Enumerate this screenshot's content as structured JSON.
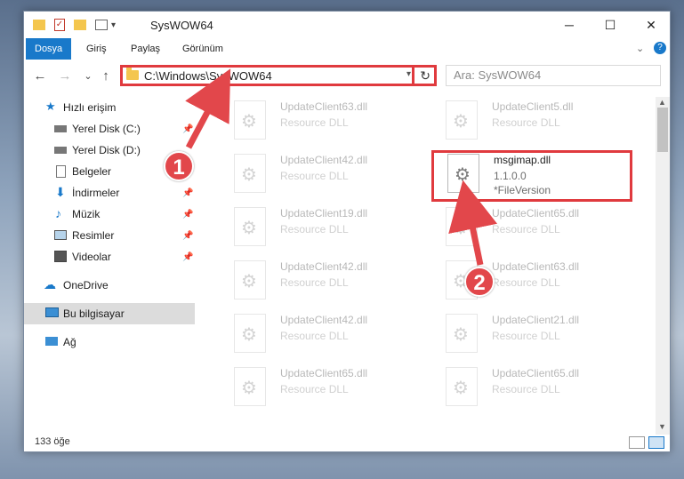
{
  "window": {
    "title": "SysWOW64",
    "controls": {
      "minimize": "─",
      "maximize": "☐",
      "close": "✕"
    }
  },
  "ribbon": {
    "tabs": [
      {
        "label": "Dosya",
        "active": true
      },
      {
        "label": "Giriş"
      },
      {
        "label": "Paylaş"
      },
      {
        "label": "Görünüm"
      }
    ],
    "help": "?"
  },
  "navigation": {
    "back": "←",
    "forward": "→",
    "recent": "⌄",
    "up": "↑",
    "address": "C:\\Windows\\SysWOW64",
    "refresh": "↻",
    "search_placeholder": "Ara: SysWOW64"
  },
  "sidebar": {
    "items": [
      {
        "label": "Hızlı erişim",
        "icon": "star-icon"
      },
      {
        "label": "Yerel Disk (C:)",
        "icon": "drive-icon",
        "pinned": true
      },
      {
        "label": "Yerel Disk (D:)",
        "icon": "drive-icon"
      },
      {
        "label": "Belgeler",
        "icon": "document-icon"
      },
      {
        "label": "İndirmeler",
        "icon": "download-icon",
        "pinned": true
      },
      {
        "label": "Müzik",
        "icon": "music-icon",
        "pinned": true
      },
      {
        "label": "Resimler",
        "icon": "picture-icon",
        "pinned": true
      },
      {
        "label": "Videolar",
        "icon": "video-icon",
        "pinned": true
      },
      {
        "label": "OneDrive",
        "icon": "cloud-icon"
      },
      {
        "label": "Bu bilgisayar",
        "icon": "computer-icon",
        "selected": true
      },
      {
        "label": "Ağ",
        "icon": "network-icon"
      }
    ]
  },
  "files": [
    {
      "name": "UpdateClient63.dll",
      "type": "Resource DLL"
    },
    {
      "name": "UpdateClient5.dll",
      "type": "Resource DLL"
    },
    {
      "name": "UpdateClient42.dll",
      "type": "Resource DLL"
    },
    {
      "name": "msgimap.dll",
      "version": "1.1.0.0",
      "detail": "*FileVersion",
      "highlighted": true
    },
    {
      "name": "UpdateClient19.dll",
      "type": "Resource DLL"
    },
    {
      "name": "UpdateClient65.dll",
      "type": "Resource DLL"
    },
    {
      "name": "UpdateClient42.dll",
      "type": "Resource DLL"
    },
    {
      "name": "UpdateClient63.dll",
      "type": "Resource DLL"
    },
    {
      "name": "UpdateClient42.dll",
      "type": "Resource DLL"
    },
    {
      "name": "UpdateClient21.dll",
      "type": "Resource DLL"
    },
    {
      "name": "UpdateClient65.dll",
      "type": "Resource DLL"
    },
    {
      "name": "UpdateClient65.dll",
      "type": "Resource DLL"
    }
  ],
  "status": {
    "count": "133 öğe"
  },
  "annotations": {
    "marker1": "1",
    "marker2": "2",
    "color": "#e2474b"
  }
}
